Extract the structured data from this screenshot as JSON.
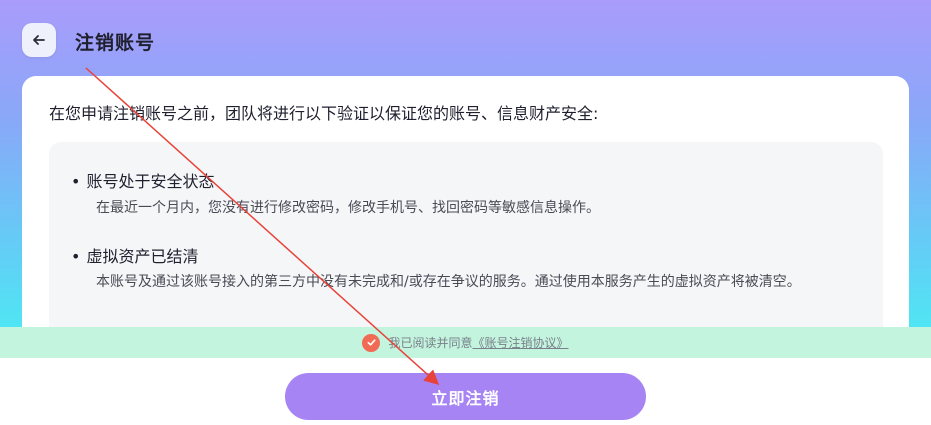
{
  "header": {
    "title": "注销账号",
    "back_icon": "arrow-left-icon"
  },
  "card": {
    "intro": "在您申请注销账号之前，团队将进行以下验证以保证您的账号、信息财产安全:",
    "rules": [
      {
        "title": "账号处于安全状态",
        "desc": "在最近一个月内，您没有进行修改密码，修改手机号、找回密码等敏感信息操作。"
      },
      {
        "title": "虚拟资产已结清",
        "desc": "本账号及通过该账号接入的第三方中没有未完成和/或存在争议的服务。通过使用本服务产生的虚拟资产将被清空。"
      }
    ]
  },
  "agreement": {
    "checked_icon": "check-circle-icon",
    "text": "我已阅读并同意",
    "link": "《账号注销协议》"
  },
  "submit": {
    "label": "立即注销"
  },
  "colors": {
    "accent": "#a784f4",
    "check": "#f06a55",
    "agree_bar": "#c3f4de",
    "annotation_line": "#e8433a"
  }
}
